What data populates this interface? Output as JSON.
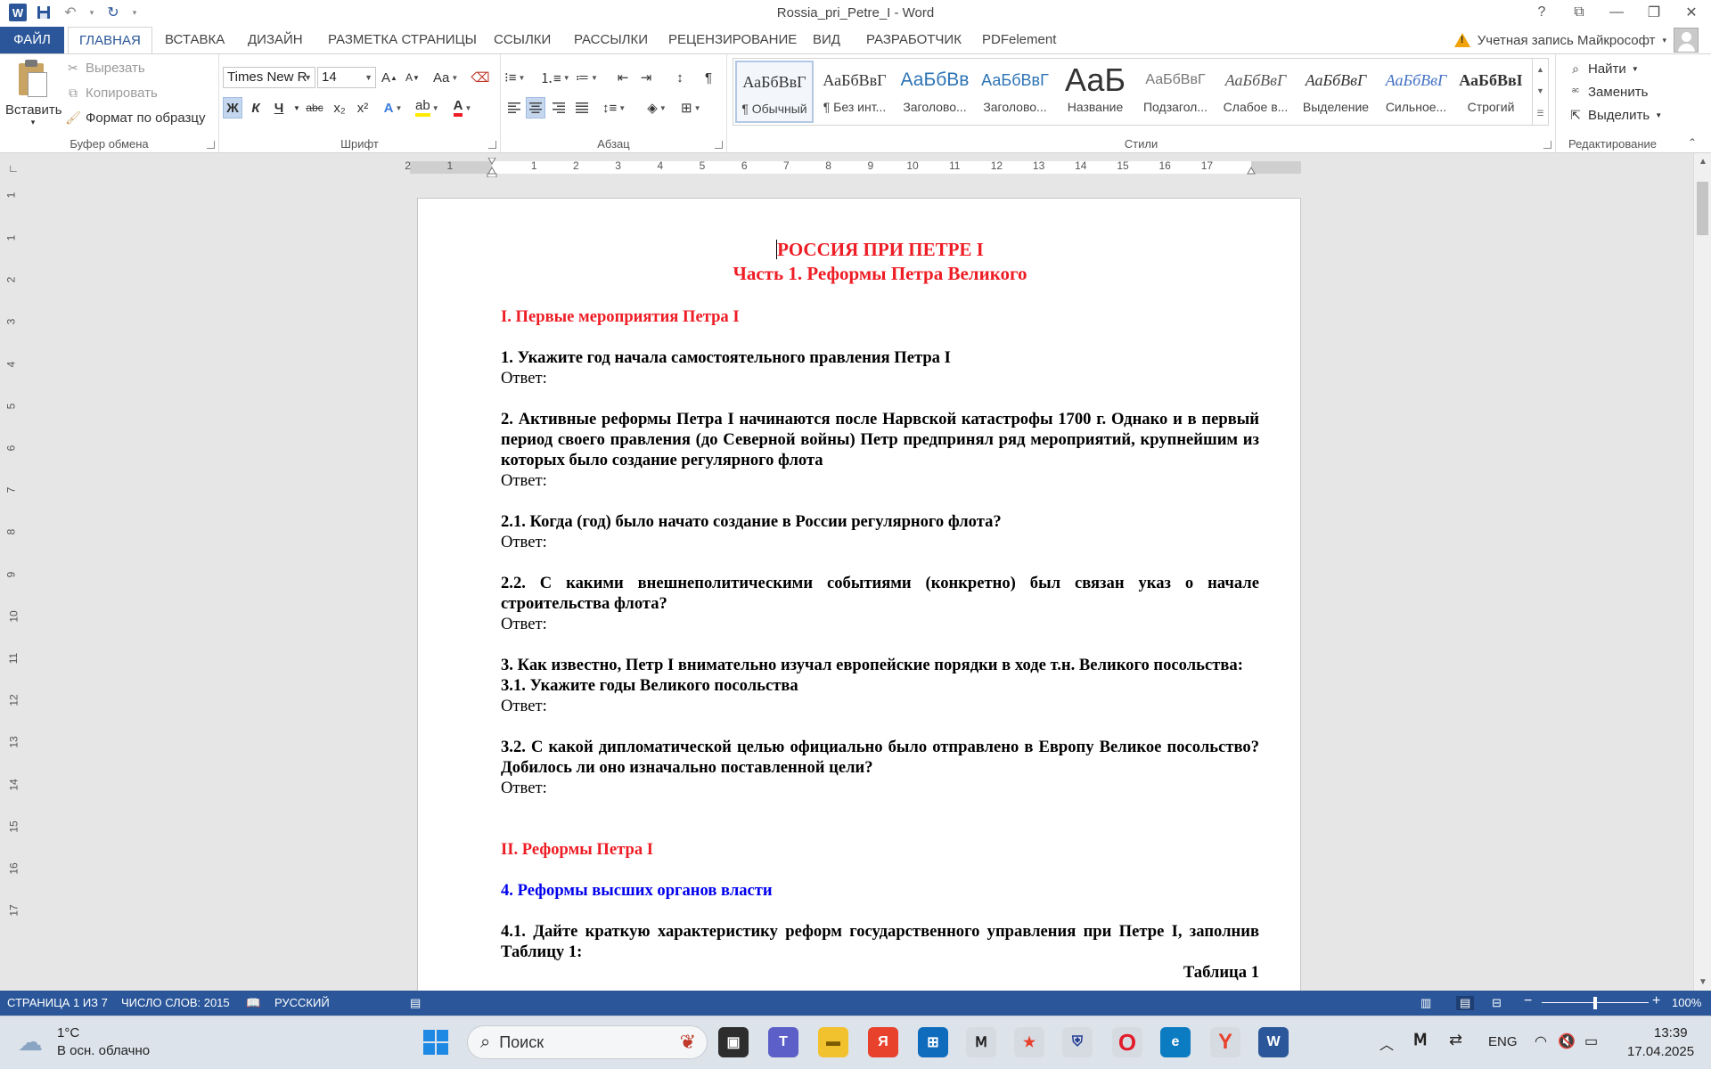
{
  "titlebar": {
    "app_icon": "word-icon",
    "title": "Rossia_pri_Petre_I - Word",
    "help": "?"
  },
  "tabs": [
    "ФАЙЛ",
    "ГЛАВНАЯ",
    "ВСТАВКА",
    "ДИЗАЙН",
    "РАЗМЕТКА СТРАНИЦЫ",
    "ССЫЛКИ",
    "РАССЫЛКИ",
    "РЕЦЕНЗИРОВАНИЕ",
    "ВИД",
    "РАЗРАБОТЧИК",
    "PDFelement"
  ],
  "account": "Учетная запись Майкрософт",
  "clipboard": {
    "paste": "Вставить",
    "cut": "Вырезать",
    "copy": "Копировать",
    "format_painter": "Формат по образцу",
    "label": "Буфер обмена"
  },
  "font": {
    "name": "Times New R",
    "size": "14",
    "grow": "A",
    "shrink": "A",
    "case": "Aa",
    "bold": "Ж",
    "italic": "К",
    "underline": "Ч",
    "strike": "abc",
    "sub": "x₂",
    "sup": "x²",
    "effects": "A",
    "color_a": "A",
    "label": "Шрифт"
  },
  "paragraph": {
    "label": "Абзац",
    "show_marks": "¶"
  },
  "styles": {
    "items": [
      {
        "sample": "АаБбВвГ",
        "name": "¶ Обычный"
      },
      {
        "sample": "АаБбВвГ",
        "name": "¶ Без инт..."
      },
      {
        "sample": "АаБбВв",
        "name": "Заголово..."
      },
      {
        "sample": "АаБбВвГ",
        "name": "Заголово..."
      },
      {
        "sample": "АаБ",
        "name": "Название"
      },
      {
        "sample": "АаБбВвГ",
        "name": "Подзагол..."
      },
      {
        "sample": "АаБбВвГ",
        "name": "Слабое в..."
      },
      {
        "sample": "АаБбВвГ",
        "name": "Выделение"
      },
      {
        "sample": "АаБбВвГ",
        "name": "Сильное..."
      },
      {
        "sample": "АаБбВвІ",
        "name": "Строгий"
      }
    ],
    "label": "Стили"
  },
  "editing": {
    "find": "Найти",
    "replace": "Заменить",
    "select": "Выделить",
    "label": "Редактирование"
  },
  "ruler": {
    "h_marks": [
      "2",
      "1",
      "1",
      "2",
      "3",
      "4",
      "5",
      "6",
      "7",
      "8",
      "9",
      "10",
      "11",
      "12",
      "13",
      "14",
      "15",
      "16",
      "17"
    ],
    "v_marks": [
      "1",
      "1",
      "2",
      "3",
      "4",
      "5",
      "6",
      "7",
      "8",
      "9",
      "10",
      "11",
      "12",
      "13",
      "14",
      "15",
      "16",
      "17"
    ]
  },
  "document": {
    "title1": "РОССИЯ ПРИ ПЕТРЕ I",
    "title2": "Часть 1. Реформы Петра Великого",
    "section1": "I. Первые мероприятия Петра I",
    "q1": "1. Укажите год начала самостоятельного правления Петра I",
    "answer": "Ответ:",
    "q2": "2. Активные реформы Петра I начинаются после Нарвской катастрофы 1700 г. Однако и в первый период своего правления (до Северной войны) Петр предпринял ряд мероприятий, крупнейшим из которых было создание регулярного флота",
    "q21": "2.1. Когда (год) было начато создание в России регулярного флота?",
    "q22": "2.2. С какими внешнеполитическими событиями (конкретно) был связан указ о начале строительства флота?",
    "q3": "3. Как известно, Петр I внимательно изучал европейские порядки в ходе т.н. Великого посольства:",
    "q31": "3.1. Укажите годы Великого посольства",
    "q32": "3.2. С какой дипломатической целью официально было отправлено в Европу Великое посольство? Добилось ли оно изначально поставленной цели?",
    "section2": "II. Реформы Петра I",
    "sub4": "4. Реформы высших органов власти",
    "q41": "4.1. Дайте краткую характеристику реформ государственного управления при Петре I, заполнив Таблицу 1:",
    "table_caption": "Таблица 1"
  },
  "status": {
    "page": "СТРАНИЦА 1 ИЗ 7",
    "words": "ЧИСЛО СЛОВ: 2015",
    "language": "РУССКИЙ",
    "zoom": "100%",
    "zoom_fraction": 0.5
  },
  "taskbar": {
    "weather_temp": "1°C",
    "weather_desc": "В осн. облачно",
    "search": "Поиск",
    "lang": "ENG",
    "time": "13:39",
    "date": "17.04.2025"
  },
  "colors": {
    "word_blue": "#2b579a",
    "heading_red": "#ee1c24",
    "heading_blue": "#0000ee"
  }
}
